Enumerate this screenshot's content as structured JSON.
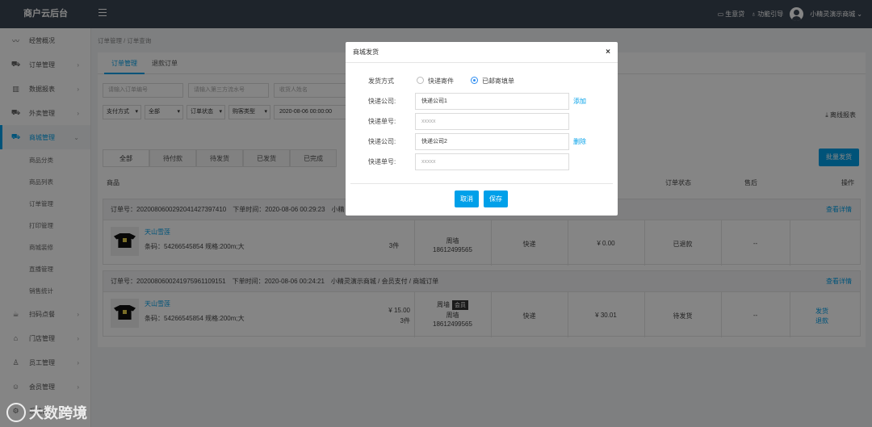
{
  "topbar": {
    "logo": "商户云后台",
    "links": [
      "生意贷",
      "功能引导"
    ],
    "username": "小精灵演示商城"
  },
  "sidebar": {
    "items": [
      {
        "label": "经营概况",
        "icon": "trend-icon"
      },
      {
        "label": "订单管理",
        "icon": "cart-icon"
      },
      {
        "label": "数据报表",
        "icon": "bar-chart-icon"
      },
      {
        "label": "外卖管理",
        "icon": "cart-icon"
      },
      {
        "label": "商城管理",
        "icon": "cart-icon"
      },
      {
        "label": "扫码点餐",
        "icon": "cup-icon"
      },
      {
        "label": "门店管理",
        "icon": "home-icon"
      },
      {
        "label": "员工管理",
        "icon": "user-icon"
      },
      {
        "label": "会员管理",
        "icon": "smile-icon"
      },
      {
        "label": "系统设置",
        "icon": "gear-icon"
      }
    ],
    "subitems": [
      "商品分类",
      "商品列表",
      "订单管理",
      "打印管理",
      "商城装修",
      "直播管理",
      "销售统计"
    ]
  },
  "breadcrumb": "订单管理  /  订单查询",
  "tabs": [
    "订单管理",
    "退款订单"
  ],
  "filters": {
    "order_no_placeholder": "请输入订单编号",
    "third_no_placeholder": "请输入第三方流水号",
    "receiver_placeholder": "收货人姓名",
    "payment": "支付方式",
    "payment_value": "全部",
    "order_status": "订单状态",
    "buy_type": "购客类型",
    "date": "2020-08-06 00:00:00"
  },
  "export_label": "离线报表",
  "status_tabs": [
    "全部",
    "待付款",
    "待发货",
    "已发货",
    "已完成"
  ],
  "batch_button": "批量发货",
  "table_headers": [
    "商品",
    "订单状态",
    "售后",
    "操作"
  ],
  "orders": [
    {
      "head": "订单号：20200806002920414273974​10　下单时间：2020-08-06 00:29:23　小精",
      "detail": "查看详情",
      "product": "天山雪莲",
      "info": "条码：54266545854  规格:200m;大",
      "qty": "3件",
      "receiver": "周墙",
      "phone": "18612499565",
      "delivery": "快递",
      "amount": "¥ 0.00",
      "status": "已退款",
      "aftersale": "--"
    },
    {
      "head": "订单号：20200806002419759611091​51　下单时间：2020-08-06 00:24:21　小精灵演示商城 / 会员支付 / 商城订单",
      "detail": "查看详情",
      "product": "天山雪莲",
      "info": "条码：54266545854  规格:200m;大",
      "price": "¥ 15.00",
      "qty": "3件",
      "receiver": "周墙",
      "badge": "会员",
      "receiver2": "周墙",
      "phone": "18612499565",
      "delivery": "快递",
      "amount": "¥ 30.01",
      "status": "待发货",
      "aftersale": "--",
      "actions": [
        "发货",
        "退款"
      ]
    }
  ],
  "modal": {
    "title": "商城发货",
    "close": "×",
    "ship_method_label": "发货方式",
    "option1": "快递寄件",
    "option2": "已邮寄填单",
    "company1_label": "快递公司:",
    "company1_value": "快递公司1",
    "add_link": "添加",
    "no1_label": "快递单号:",
    "no1_placeholder": "xxxxx",
    "company2_label": "快递公司:",
    "company2_value": "快递公司2",
    "delete_link": "删除",
    "no2_label": "快递单号:",
    "no2_placeholder": "xxxxx",
    "cancel": "取消",
    "save": "保存"
  },
  "watermark": "大数跨境",
  "accent_color": "#00a0e9"
}
